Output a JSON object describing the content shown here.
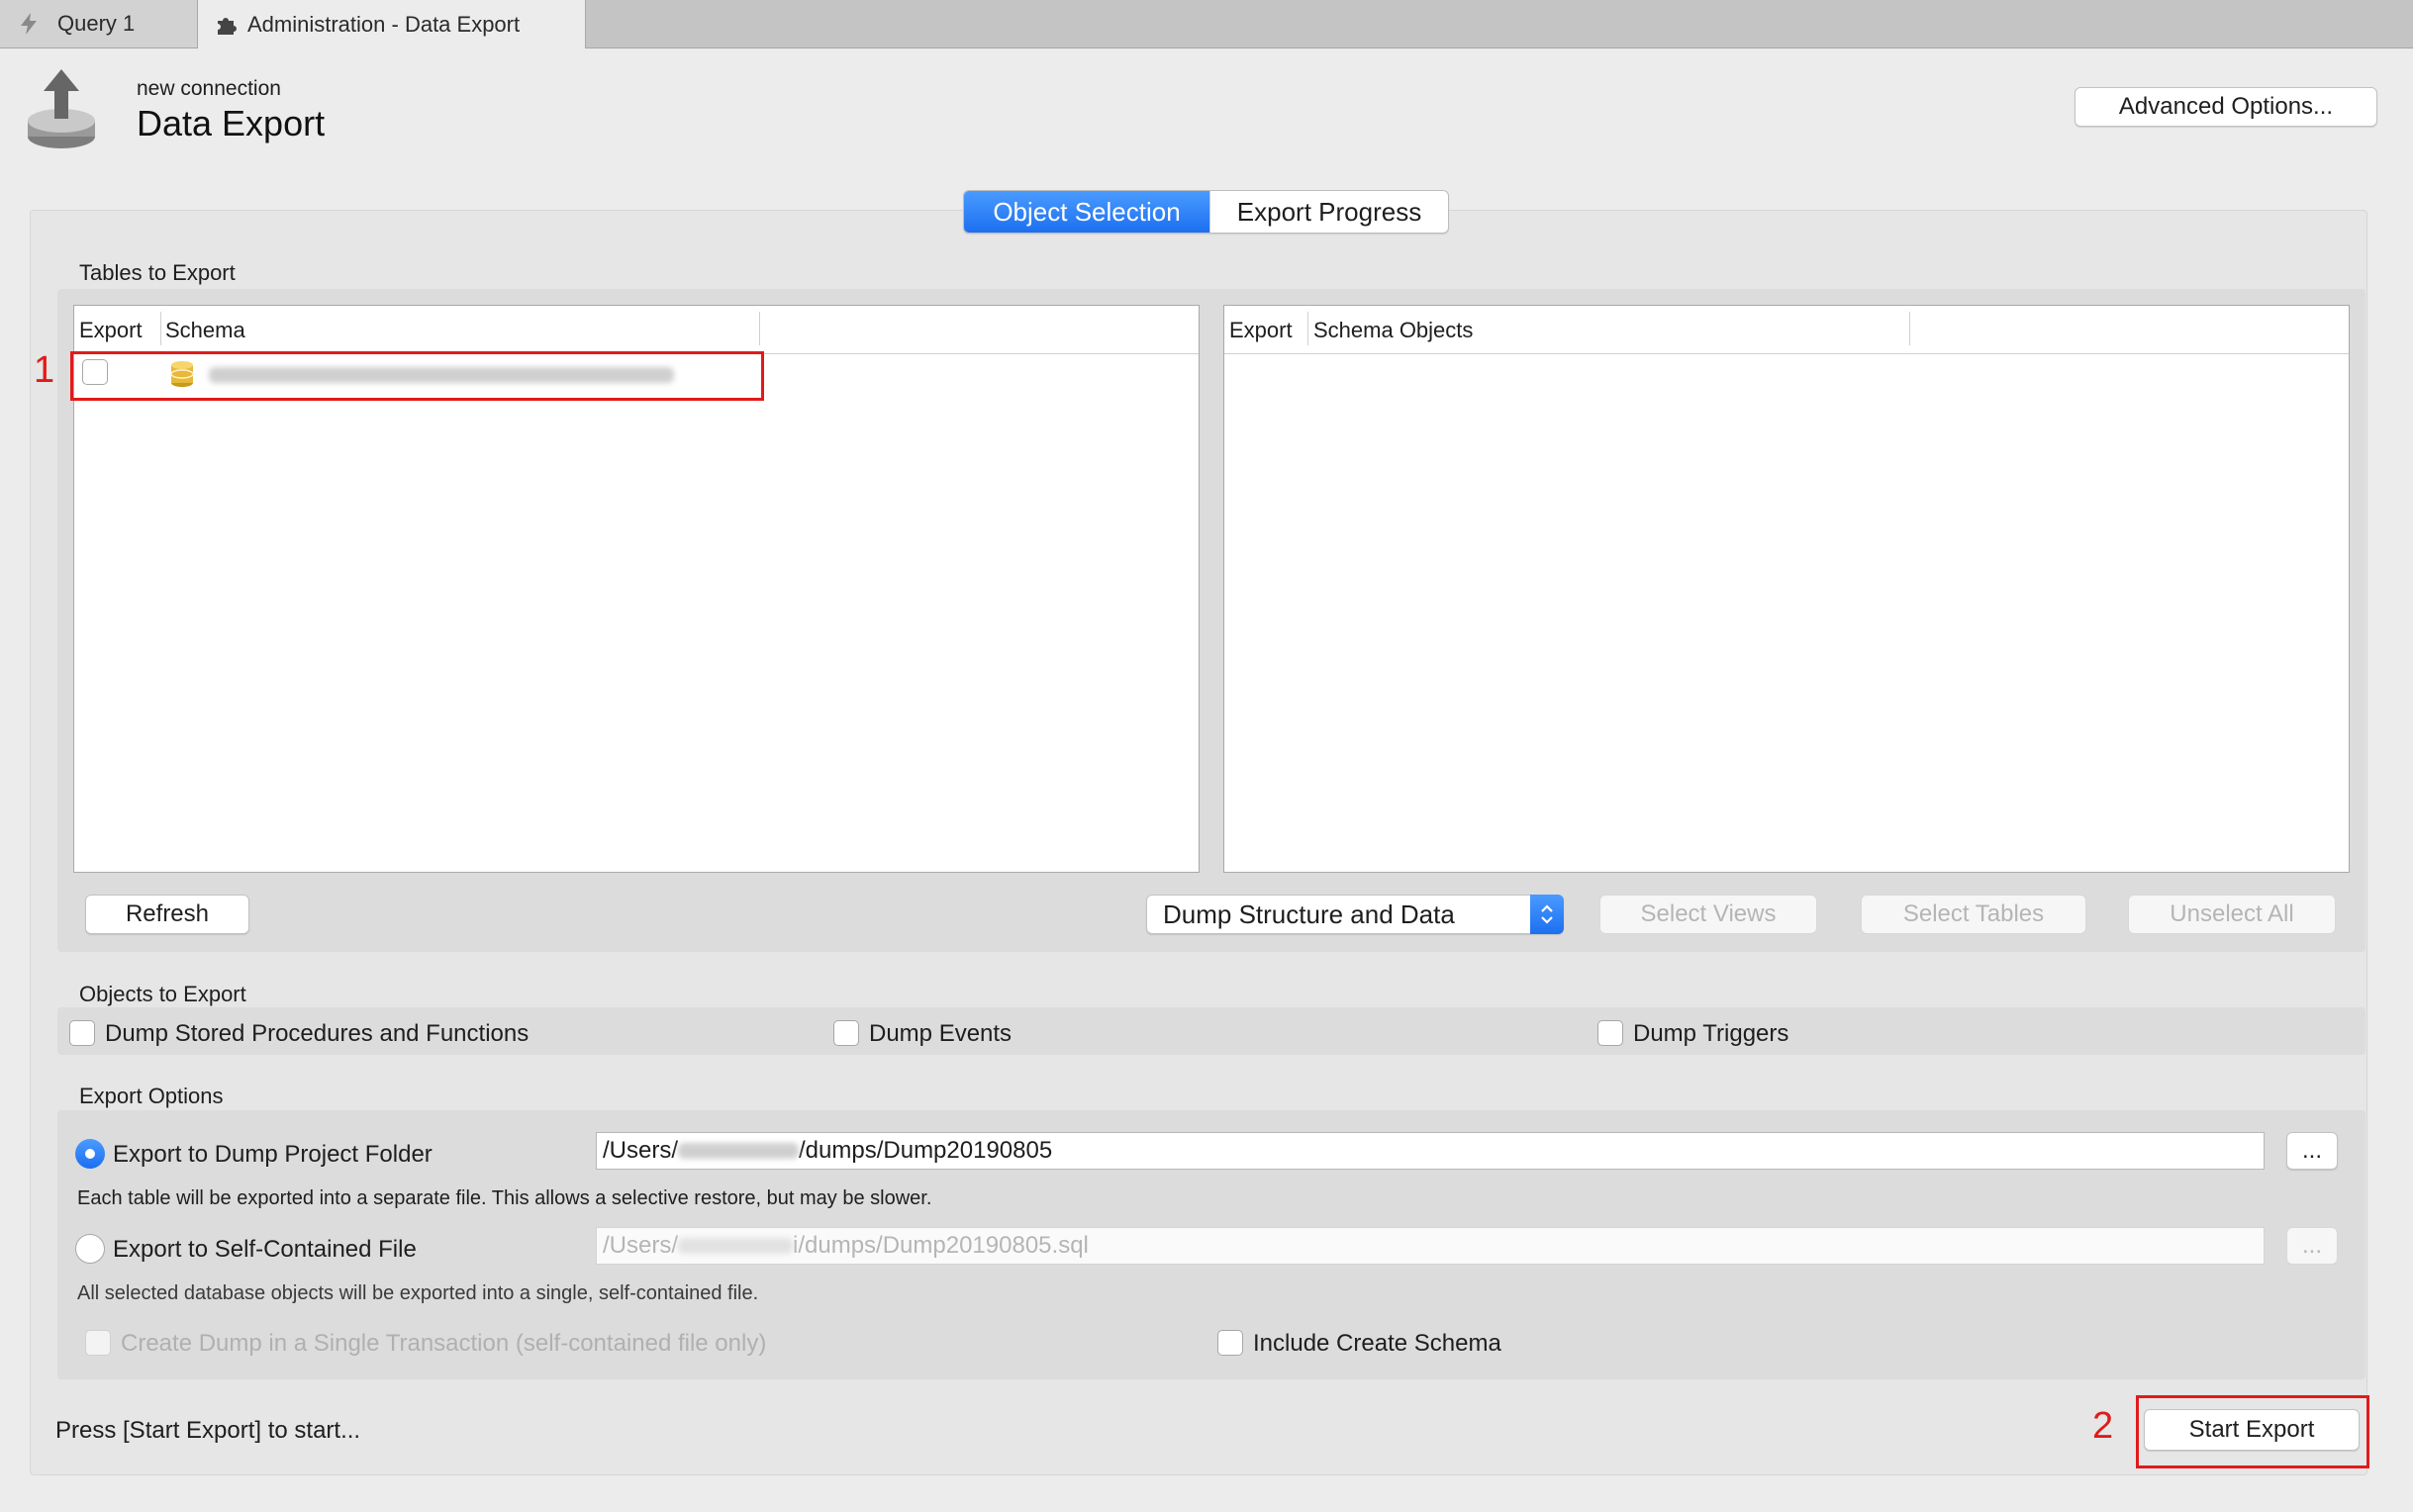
{
  "tabs": [
    {
      "label": "Query 1",
      "icon": "lightning-icon"
    },
    {
      "label": "Administration - Data Export",
      "icon": "puzzle-icon"
    }
  ],
  "header": {
    "connection": "new connection",
    "title": "Data Export",
    "advanced_button": "Advanced Options..."
  },
  "segments": {
    "object_selection": "Object Selection",
    "export_progress": "Export Progress"
  },
  "tables_section": {
    "label": "Tables to Export",
    "left_columns": [
      "Export",
      "Schema"
    ],
    "right_columns": [
      "Export",
      "Schema Objects"
    ],
    "refresh_button": "Refresh",
    "dump_select": "Dump Structure and Data",
    "select_views": "Select Views",
    "select_tables": "Select Tables",
    "unselect_all": "Unselect All"
  },
  "objects_section": {
    "label": "Objects to Export",
    "procedures": "Dump Stored Procedures and Functions",
    "events": "Dump Events",
    "triggers": "Dump Triggers"
  },
  "export_options": {
    "label": "Export Options",
    "folder_option": "Export to Dump Project Folder",
    "folder_path_prefix": "/Users/",
    "folder_path_suffix": "/dumps/Dump20190805",
    "folder_note": "Each table will be exported into a separate file. This allows a selective restore, but may be slower.",
    "file_option": "Export to Self-Contained File",
    "file_path_prefix": "/Users/",
    "file_path_suffix": "i/dumps/Dump20190805.sql",
    "file_note": "All selected database objects will be exported into a single, self-contained file.",
    "single_transaction": "Create Dump in a Single Transaction (self-contained file only)",
    "include_schema": "Include Create Schema",
    "browse_label": "..."
  },
  "footer": {
    "status": "Press [Start Export] to start...",
    "start_button": "Start Export"
  },
  "annotations": {
    "one": "1",
    "two": "2"
  },
  "colors": {
    "accent": "#1c6ff0",
    "annotation": "#e01b1b"
  }
}
